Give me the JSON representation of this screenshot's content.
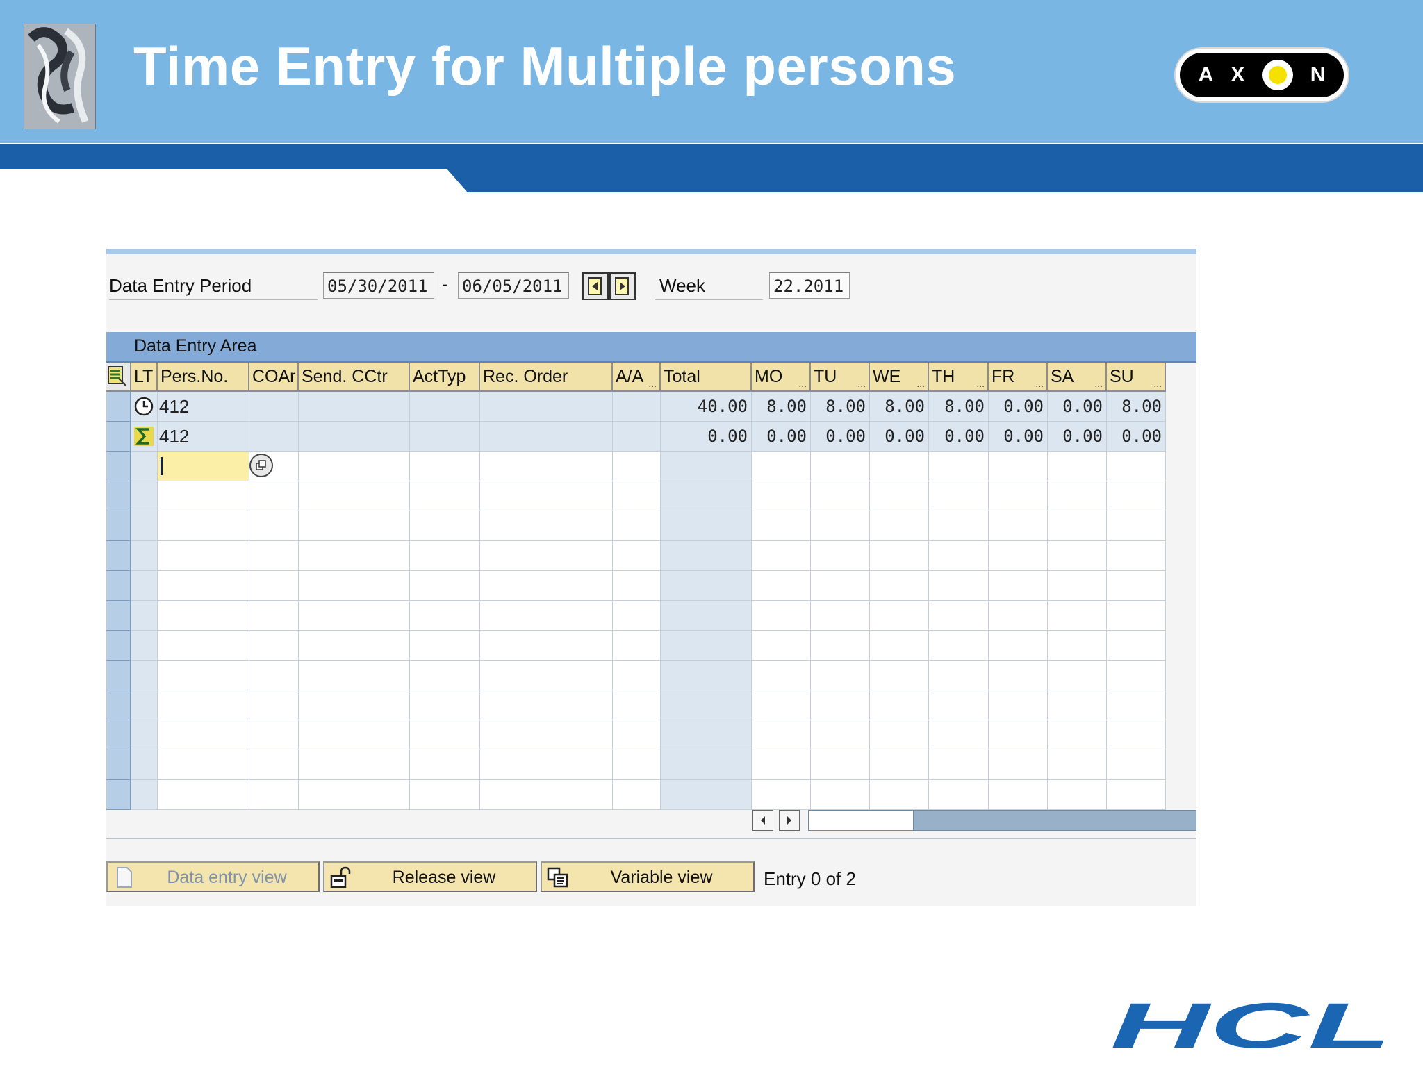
{
  "slide": {
    "title": "Time Entry for Multiple persons",
    "axon_letters": [
      "A",
      "X",
      "N"
    ],
    "hcl_logo": "HCL"
  },
  "header": {
    "period_label": "Data Entry Period",
    "period_from": "05/30/2011",
    "period_sep": "-",
    "period_to": "06/05/2011",
    "week_label": "Week",
    "week_value": "22.2011"
  },
  "area": {
    "title": "Data Entry Area"
  },
  "table": {
    "columns": [
      "LT",
      "Pers.No.",
      "COAr",
      "Send. CCtr",
      "ActTyp",
      "Rec. Order",
      "A/A",
      "Total",
      "MO",
      "TU",
      "WE",
      "TH",
      "FR",
      "SA",
      "SU"
    ],
    "rows": [
      {
        "lt_icon": "clock-icon",
        "pers_no": "412",
        "total": "40.00",
        "days": [
          "8.00",
          "8.00",
          "8.00",
          "8.00",
          "0.00",
          "0.00",
          "8.00"
        ]
      },
      {
        "lt_icon": "sigma-icon",
        "pers_no": "412",
        "total": "0.00",
        "days": [
          "0.00",
          "0.00",
          "0.00",
          "0.00",
          "0.00",
          "0.00",
          "0.00"
        ]
      }
    ]
  },
  "footer": {
    "data_entry_view": "Data entry view",
    "release_view": "Release view",
    "variable_view": "Variable view",
    "entry_status": "Entry 0 of 2"
  },
  "colors": {
    "banner": "#7ab6e3",
    "bluebar": "#1a5fa8",
    "header_cell": "#f0e2a8",
    "area_head": "#84abd7"
  }
}
